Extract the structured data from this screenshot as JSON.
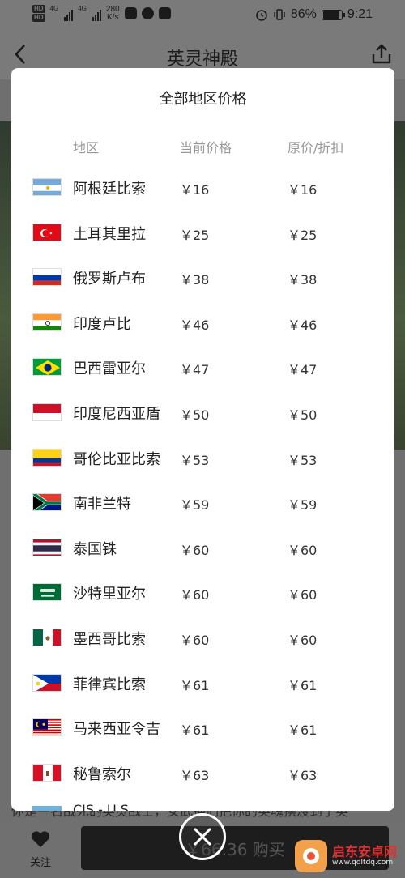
{
  "status_bar": {
    "hd1": "HD",
    "hd2": "HD",
    "sig1_label": "4G",
    "sig2_label": "4G",
    "speed_value": "280",
    "speed_unit": "K/s",
    "battery_pct": "86%",
    "battery_level": 0.86,
    "time": "9:21"
  },
  "header": {
    "title": "英灵神殿"
  },
  "modal": {
    "title": "全部地区价格",
    "col_region": "地区",
    "col_current": "当前价格",
    "col_original": "原价/折扣",
    "rows": [
      {
        "region": "阿根廷比索",
        "price": "￥16",
        "orig": "￥16",
        "flag": "argentina-flag-icon"
      },
      {
        "region": "土耳其里拉",
        "price": "￥25",
        "orig": "￥25",
        "flag": "turkey-flag-icon"
      },
      {
        "region": "俄罗斯卢布",
        "price": "￥38",
        "orig": "￥38",
        "flag": "russia-flag-icon"
      },
      {
        "region": "印度卢比",
        "price": "￥46",
        "orig": "￥46",
        "flag": "india-flag-icon"
      },
      {
        "region": "巴西雷亚尔",
        "price": "￥47",
        "orig": "￥47",
        "flag": "brazil-flag-icon"
      },
      {
        "region": "印度尼西亚盾",
        "price": "￥50",
        "orig": "￥50",
        "flag": "indonesia-flag-icon"
      },
      {
        "region": "哥伦比亚比索",
        "price": "￥53",
        "orig": "￥53",
        "flag": "colombia-flag-icon"
      },
      {
        "region": "南非兰特",
        "price": "￥59",
        "orig": "￥59",
        "flag": "south-africa-flag-icon"
      },
      {
        "region": "泰国铢",
        "price": "￥60",
        "orig": "￥60",
        "flag": "thailand-flag-icon"
      },
      {
        "region": "沙特里亚尔",
        "price": "￥60",
        "orig": "￥60",
        "flag": "saudi-arabia-flag-icon"
      },
      {
        "region": "墨西哥比索",
        "price": "￥60",
        "orig": "￥60",
        "flag": "mexico-flag-icon"
      },
      {
        "region": "菲律宾比索",
        "price": "￥61",
        "orig": "￥61",
        "flag": "philippines-flag-icon"
      },
      {
        "region": "马来西亚令吉",
        "price": "￥61",
        "orig": "￥61",
        "flag": "malaysia-flag-icon"
      },
      {
        "region": "秘鲁索尔",
        "price": "￥63",
        "orig": "￥63",
        "flag": "peru-flag-icon"
      }
    ],
    "partial_row": "CIS - U.S."
  },
  "background": {
    "description": "你是一名战死的英灵战士，女武神们把你的英魂摆渡到了英",
    "follow_label": "关注",
    "buy_label": "￥66.36 购买"
  },
  "watermark": {
    "name": "启东安卓网",
    "url": "www.qdltdq.com"
  },
  "colors": {
    "modal_bg": "#ffffff",
    "overlay": "#6f6f6f",
    "header_text": "#999999"
  }
}
